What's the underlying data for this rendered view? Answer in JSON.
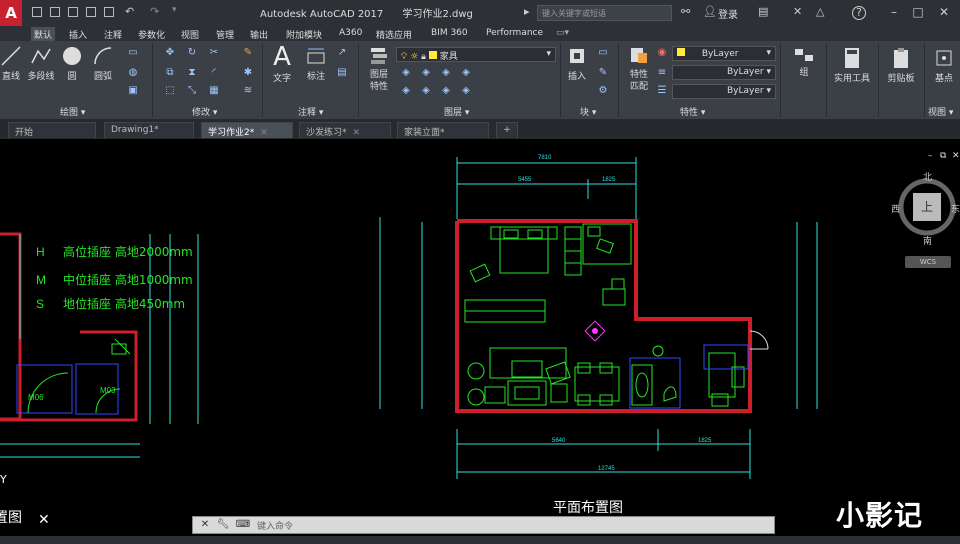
{
  "app": {
    "logo": "A",
    "title": "Autodesk AutoCAD 2017",
    "filename": "学习作业2.dwg",
    "search_placeholder": "键入关键字或短语",
    "login_label": "登录",
    "help_label": "?"
  },
  "ribbon_tabs": [
    "默认",
    "插入",
    "注释",
    "参数化",
    "视图",
    "管理",
    "输出",
    "附加模块",
    "A360",
    "精选应用",
    "BIM 360",
    "Performance"
  ],
  "ribbon": {
    "draw": {
      "title": "绘图",
      "buttons": [
        "直线",
        "多段线",
        "圆",
        "圆弧"
      ]
    },
    "modify": {
      "title": "修改"
    },
    "annotation": {
      "title": "注释",
      "buttons": [
        "文字",
        "标注"
      ]
    },
    "layers": {
      "title": "图层",
      "props_label": "图层\n特性",
      "layer_name": "家具"
    },
    "block": {
      "title": "块",
      "insert_label": "插入"
    },
    "properties": {
      "title": "特性",
      "match_label": "特性\n匹配",
      "color": "ByLayer",
      "linetype": "ByLayer",
      "lineweight": "ByLayer"
    },
    "group": {
      "title": "组",
      "label": "组"
    },
    "utilities": {
      "label": "实用工具"
    },
    "clipboard": {
      "label": "剪贴板"
    },
    "view": {
      "title": "视图",
      "base_label": "基点"
    }
  },
  "doc_tabs": [
    {
      "label": "开始",
      "active": false
    },
    {
      "label": "Drawing1*",
      "active": false
    },
    {
      "label": "学习作业2*",
      "active": true
    },
    {
      "label": "沙发练习*",
      "active": false
    },
    {
      "label": "家装立面*",
      "active": false
    }
  ],
  "canvas": {
    "legend": [
      {
        "code": "H",
        "text": "高位插座 高地2000mm"
      },
      {
        "code": "M",
        "text": "中位插座 高地1000mm"
      },
      {
        "code": "S",
        "text": "地位插座 高地450mm"
      }
    ],
    "door_labels": [
      "M06",
      "M03"
    ],
    "left_caption": "置图",
    "right_caption": "平面布置图",
    "viewcube": {
      "north": "北",
      "south": "南",
      "west": "西",
      "east": "东",
      "face": "上",
      "wcs": "WCS"
    },
    "dims": {
      "top_total": "7810",
      "top_a": "5455",
      "top_b": "1825",
      "bottom_a": "5640",
      "bottom_b": "1825",
      "bottom_total": "12745"
    }
  },
  "command_line": {
    "placeholder": "键入命令"
  },
  "watermark": "小影记",
  "colors": {
    "accent_red": "#c8202f",
    "cad_wall": "#cc1f2a",
    "cad_green": "#23e623",
    "cad_cyan": "#2fe0d8",
    "cad_blue": "#2f49ff"
  }
}
